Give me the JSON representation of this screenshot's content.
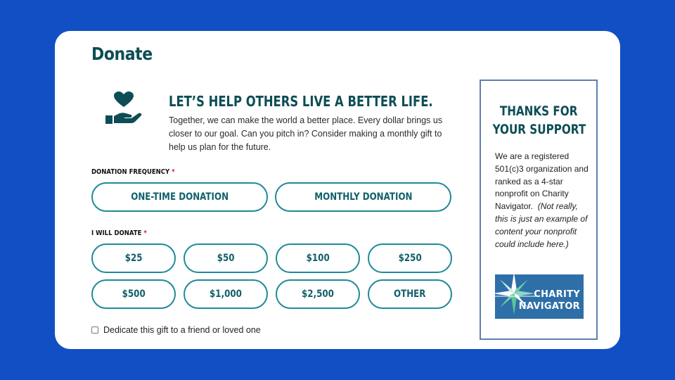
{
  "page": {
    "title": "Donate"
  },
  "intro": {
    "headline": "LET’S HELP OTHERS LIVE A BETTER LIFE.",
    "body": "Together, we can make the world a better place. Every dollar brings us closer to our goal. Can you pitch in? Consider making a monthly gift to help us plan for the future."
  },
  "frequency": {
    "label": "DONATION FREQUENCY",
    "required_mark": "*",
    "options": [
      "ONE-TIME DONATION",
      "MONTHLY DONATION"
    ]
  },
  "amount": {
    "label": "I WILL DONATE",
    "required_mark": "*",
    "options": [
      "$25",
      "$50",
      "$100",
      "$250",
      "$500",
      "$1,000",
      "$2,500",
      "OTHER"
    ]
  },
  "dedicate": {
    "label": "Dedicate this gift to a friend or loved one",
    "checked": false
  },
  "sidebar": {
    "title_line1": "THANKS FOR",
    "title_line2": "YOUR SUPPORT",
    "body_plain": "We are a registered 501(c)3 organization and ranked as a 4-star nonprofit on Charity Navigator.",
    "body_italic": "(Not really, this is just an example of content your nonprofit could include here.)",
    "logo_line1": "CHARITY",
    "logo_line2": "NAVIGATOR"
  },
  "colors": {
    "background": "#1150c4",
    "brand_teal": "#0d4d55",
    "button_border": "#1f8a96",
    "required": "#c8202c",
    "logo_blue": "#2e6fa8"
  },
  "icons": {
    "hero": "heart-hand-icon",
    "logo": "charity-navigator-star-icon"
  }
}
